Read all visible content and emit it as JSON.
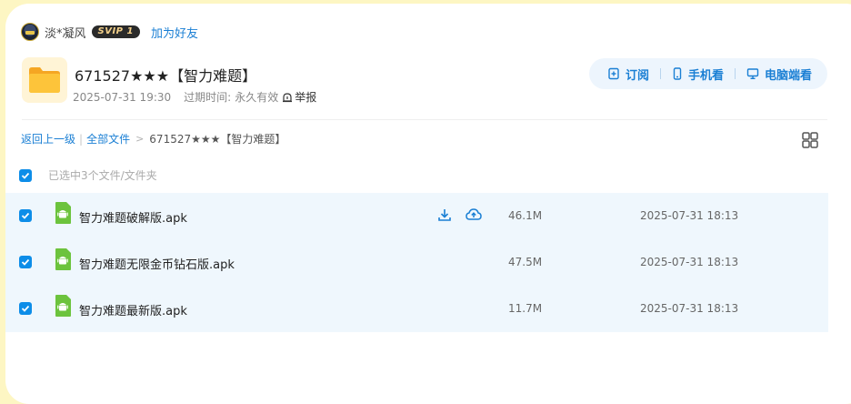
{
  "user": {
    "name": "淡*凝风",
    "vip_badge": "SVIP 1",
    "add_friend": "加为好友"
  },
  "file": {
    "title": "671527★★★【智力难题】",
    "date": "2025-07-31 19:30",
    "expire_label": "过期时间:",
    "expire_value": "永久有效",
    "report": "举报"
  },
  "actions": {
    "subscribe": "订阅",
    "phone_view": "手机看",
    "pc_view": "电脑端看"
  },
  "breadcrumb": {
    "back": "返回上一级",
    "all_files": "全部文件",
    "current": "671527★★★【智力难题】"
  },
  "selection": {
    "text": "已选中3个文件/文件夹"
  },
  "files": [
    {
      "name": "智力难题破解版.apk",
      "size": "46.1M",
      "date": "2025-07-31 18:13"
    },
    {
      "name": "智力难题无限金币钻石版.apk",
      "size": "47.5M",
      "date": "2025-07-31 18:13"
    },
    {
      "name": "智力难题最新版.apk",
      "size": "11.7M",
      "date": "2025-07-31 18:13"
    }
  ],
  "colors": {
    "accent": "#1a7fd4",
    "checkbox": "#0d8de8",
    "row_bg": "#eff7fd",
    "page_bg": "#fdf6c3",
    "folder": "#f7b731",
    "android": "#6cc33d"
  }
}
